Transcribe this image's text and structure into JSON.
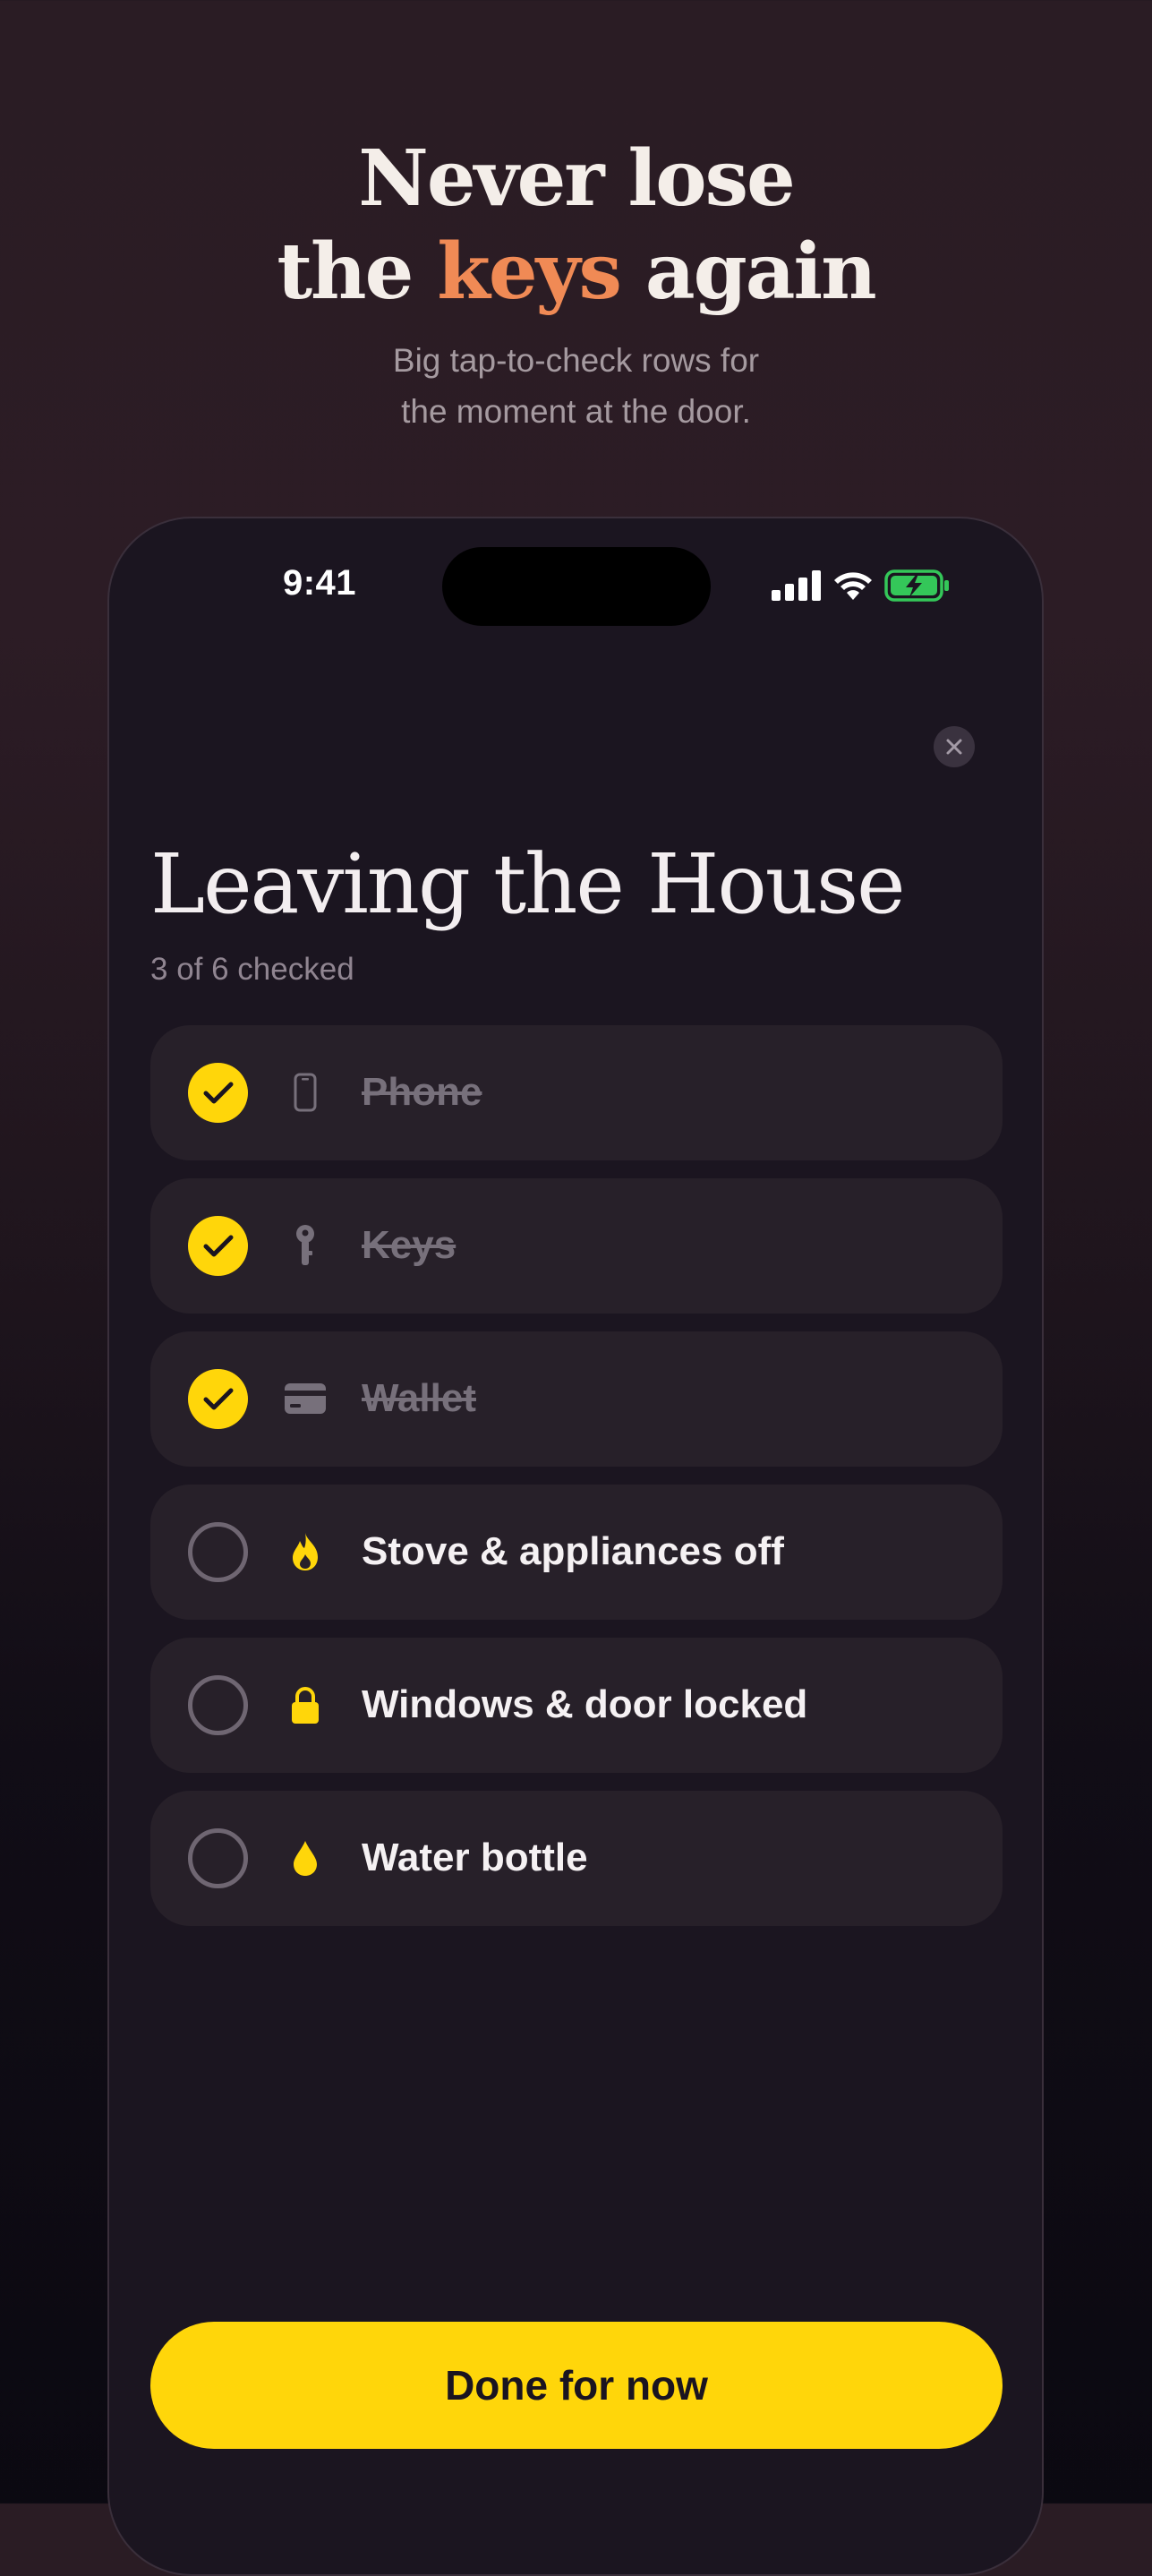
{
  "hero": {
    "title_line1": "Never lose",
    "title_prefix": "the",
    "title_accent": "keys",
    "title_suffix": "again",
    "subtitle_line1": "Big tap-to-check rows for",
    "subtitle_line2": "the moment at the door."
  },
  "status_bar": {
    "time": "9:41",
    "icons": [
      "signal-icon",
      "wifi-icon",
      "battery-charging-icon"
    ]
  },
  "checklist": {
    "title": "Leaving the House",
    "progress": "3 of 6 checked",
    "items": [
      {
        "label": "Phone",
        "icon": "phone-icon",
        "checked": true
      },
      {
        "label": "Keys",
        "icon": "key-icon",
        "checked": true
      },
      {
        "label": "Wallet",
        "icon": "wallet-card-icon",
        "checked": true
      },
      {
        "label": "Stove & appliances off",
        "icon": "flame-icon",
        "checked": false
      },
      {
        "label": "Windows & door locked",
        "icon": "lock-icon",
        "checked": false
      },
      {
        "label": "Water bottle",
        "icon": "water-drop-icon",
        "checked": false
      }
    ]
  },
  "done_button": {
    "label": "Done for now"
  },
  "colors": {
    "accent_yellow": "#ffd60a",
    "accent_orange": "#f08a55",
    "battery_green": "#34c759",
    "row_background": "#272029"
  }
}
